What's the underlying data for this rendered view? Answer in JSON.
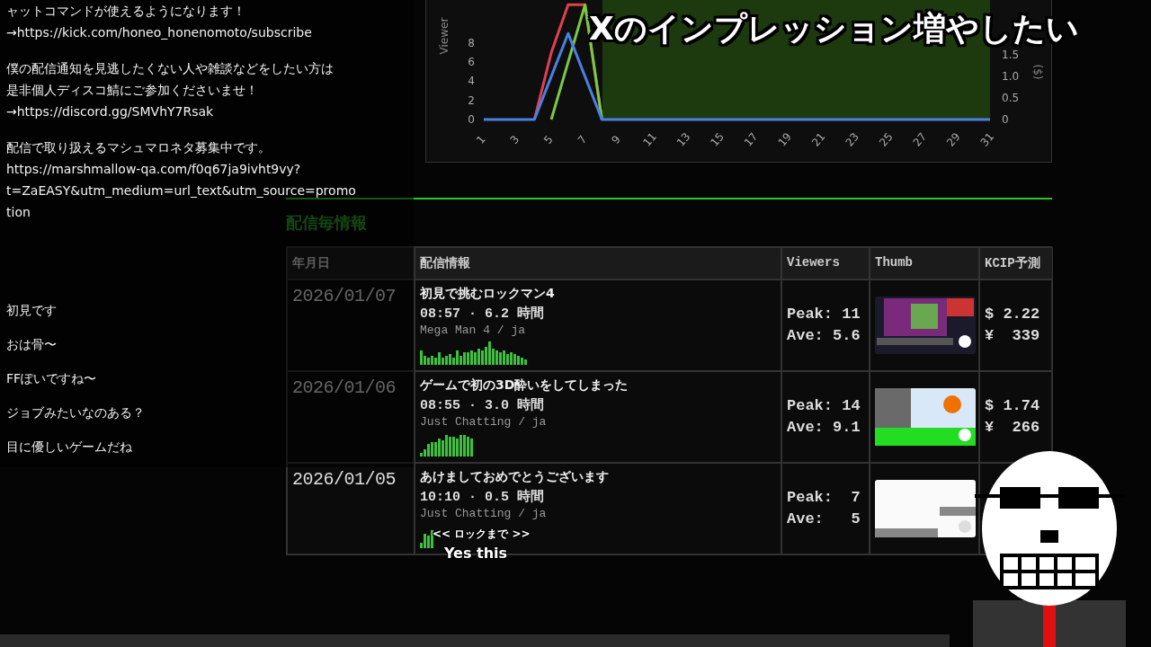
{
  "description": [
    {
      "lines": [
        "ャットコマンドが使えるようになります！",
        "→https://kick.com/honeo_honenomoto/subscribe"
      ]
    },
    {
      "lines": [
        "僕の配信通知を見逃したくない人や雑談などをしたい方は",
        "是非個人ディスコ鯖にご参加くださいませ！",
        "→https://discord.gg/SMVhY7Rsak"
      ]
    },
    {
      "lines": [
        "配信で取り扱えるマシュマロネタ募集中です。",
        "https://marshmallow-qa.com/f0q67ja9ivht9vy?",
        "t=ZaEASY&utm_medium=url_text&utm_source=promo",
        "tion"
      ]
    }
  ],
  "chat_messages": [
    "初見です",
    "おは骨〜",
    "FFぽいですね〜",
    "ジョブみたいなのある？",
    "目に優しいゲームだね"
  ],
  "chart": {
    "chart_data": {
      "type": "line",
      "ylabel": "Viewer",
      "x": [
        1,
        2,
        3,
        4,
        5,
        6,
        7,
        8,
        9,
        10,
        11,
        12,
        13,
        14,
        15,
        16,
        17,
        18,
        19,
        20,
        21,
        22,
        23,
        24,
        25,
        26,
        27,
        28,
        29,
        30,
        31
      ],
      "xlim": [
        1,
        31
      ],
      "ylim": [
        0,
        12.5
      ],
      "yticks": [
        0,
        2,
        4,
        6,
        8
      ],
      "xticks": [
        1,
        3,
        5,
        7,
        9,
        11,
        13,
        15,
        17,
        19,
        21,
        23,
        25,
        27,
        29,
        31
      ],
      "series": [
        {
          "color": "#e04050",
          "values": [
            null,
            null,
            null,
            0,
            7,
            12,
            12,
            0,
            null,
            null,
            null,
            null,
            null,
            null,
            null,
            null,
            null,
            null,
            null,
            null,
            null,
            null,
            null,
            null,
            null,
            null,
            null,
            null,
            null,
            null,
            null
          ]
        },
        {
          "color": "#7ac943",
          "values": [
            null,
            null,
            null,
            null,
            0,
            6,
            12,
            0,
            null,
            null,
            null,
            null,
            null,
            null,
            null,
            null,
            null,
            null,
            null,
            null,
            null,
            null,
            null,
            null,
            null,
            null,
            null,
            null,
            null,
            null,
            null
          ]
        },
        {
          "color": "#4a80e0",
          "values": [
            0,
            0,
            0,
            0,
            4.5,
            9,
            4.5,
            0,
            0,
            0,
            0,
            0,
            0,
            0,
            0,
            0,
            0,
            0,
            0,
            0,
            0,
            0,
            0,
            0,
            0,
            0,
            0,
            0,
            0,
            0,
            0
          ]
        }
      ]
    },
    "right_axis": {
      "label": "($)",
      "ticks": [
        "1.5",
        "1.0",
        "0.5",
        "0"
      ]
    }
  },
  "section_title": "配信毎情報",
  "table": {
    "columns": [
      "年月日",
      "配信情報",
      "Viewers",
      "Thumb",
      "KCIP予測"
    ],
    "rows": [
      {
        "date": "2026/01/07",
        "title": "初見で挑むロックマン4",
        "time": "08:57 · 6.2 時間",
        "category": "Mega Man 4 / ja",
        "peak": "Peak: 11",
        "ave": "Ave: 5.6",
        "usd": "$ 2.22",
        "jpy": "¥  339"
      },
      {
        "date": "2026/01/06",
        "title": "ゲームで初の3D酔いをしてしまった",
        "time": "08:55 · 3.0 時間",
        "category": "Just Chatting / ja",
        "peak": "Peak: 14",
        "ave": "Ave: 9.1",
        "usd": "$ 1.74",
        "jpy": "¥  266"
      },
      {
        "date": "2026/01/05",
        "title": "あけましておめでとうございます",
        "time": "10:10 · 0.5 時間",
        "category": "Just Chatting / ja",
        "peak": "Peak:  7",
        "ave": "Ave:   5"
      }
    ]
  },
  "captions": {
    "headline": "Xのインプレッション増やしたい",
    "subtitle_top": "<< ロックまで >>",
    "subtitle_bottom": "Yes this"
  }
}
